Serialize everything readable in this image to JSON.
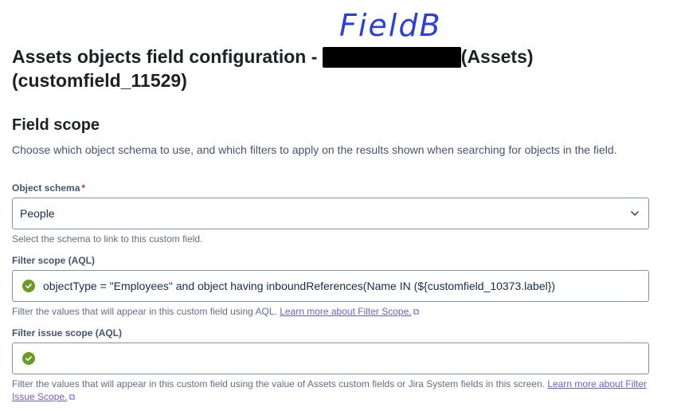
{
  "annotation": "FieldB",
  "header": {
    "title_part1": "Assets objects field configuration -",
    "title_part2": "(Assets)",
    "title_line2": "(customfield_11529)"
  },
  "section": {
    "title": "Field scope",
    "description": "Choose which object schema to use, and which filters to apply on the results shown when searching for objects in the field."
  },
  "object_schema": {
    "label": "Object schema",
    "required_mark": "*",
    "value": "People",
    "help": "Select the schema to link to this custom field."
  },
  "filter_scope": {
    "label": "Filter scope (AQL)",
    "value": "objectType = \"Employees\" and object having inboundReferences(Name IN (${customfield_10373.label})",
    "help": "Filter the values that will appear in this custom field using AQL.",
    "link": "Learn more about Filter Scope."
  },
  "filter_issue_scope": {
    "label": "Filter issue scope (AQL)",
    "value": "",
    "help": "Filter the values that will appear in this custom field using the value of Assets custom fields or Jira System fields in this screen.",
    "link": "Learn more about Filter Issue Scope."
  },
  "icons": {
    "valid": "check-circle-icon",
    "chevron": "chevron-down-icon",
    "external": "external-link-icon"
  }
}
